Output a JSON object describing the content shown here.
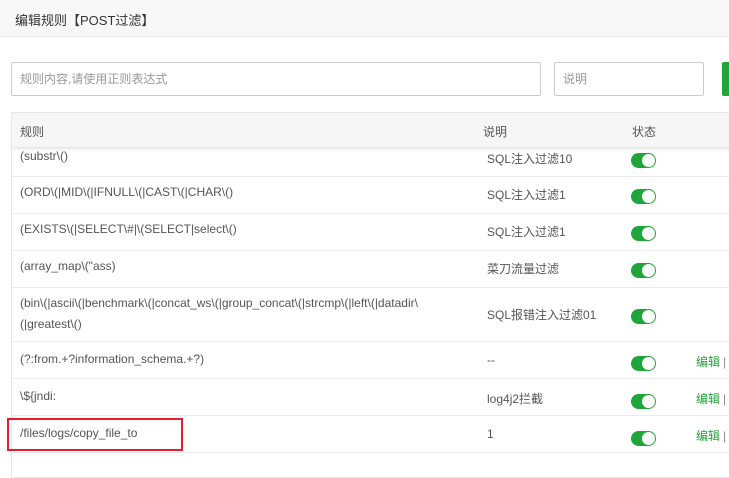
{
  "header": {
    "title": "编辑规则【POST过滤】"
  },
  "form": {
    "rule_placeholder": "规则内容,请使用正则表达式",
    "desc_placeholder": "说明"
  },
  "table": {
    "columns": {
      "rule": "规则",
      "desc": "说明",
      "status": "状态"
    },
    "rows": [
      {
        "rule": "(substr\\()",
        "desc": "SQL注入过滤10",
        "enabled": true,
        "edit": "",
        "sep": ""
      },
      {
        "rule": "(ORD\\(|MID\\(|IFNULL\\(|CAST\\(|CHAR\\()",
        "desc": "SQL注入过滤1",
        "enabled": true,
        "edit": "",
        "sep": ""
      },
      {
        "rule": "(EXISTS\\(|SELECT\\#|\\(SELECT|select\\()",
        "desc": "SQL注入过滤1",
        "enabled": true,
        "edit": "",
        "sep": ""
      },
      {
        "rule": "(array_map\\(\"ass)",
        "desc": "菜刀流量过滤",
        "enabled": true,
        "edit": "",
        "sep": ""
      },
      {
        "rule": "(bin\\(|ascii\\(|benchmark\\(|concat_ws\\(|group_concat\\(|strcmp\\(|left\\(|datadir\\(|greatest\\()",
        "desc": "SQL报错注入过滤01",
        "enabled": true,
        "edit": "",
        "sep": ""
      },
      {
        "rule": "(?:from.+?information_schema.+?)",
        "desc": "--",
        "enabled": true,
        "edit": "编辑",
        "sep": "|"
      },
      {
        "rule": "\\${jndi:",
        "desc": "log4j2拦截",
        "enabled": true,
        "edit": "编辑",
        "sep": "|"
      },
      {
        "rule": "/files/logs/copy_file_to",
        "desc": "1",
        "enabled": true,
        "edit": "编辑",
        "sep": "|"
      }
    ]
  },
  "colors": {
    "accent": "#20a53a",
    "highlight": "#e3202a"
  }
}
